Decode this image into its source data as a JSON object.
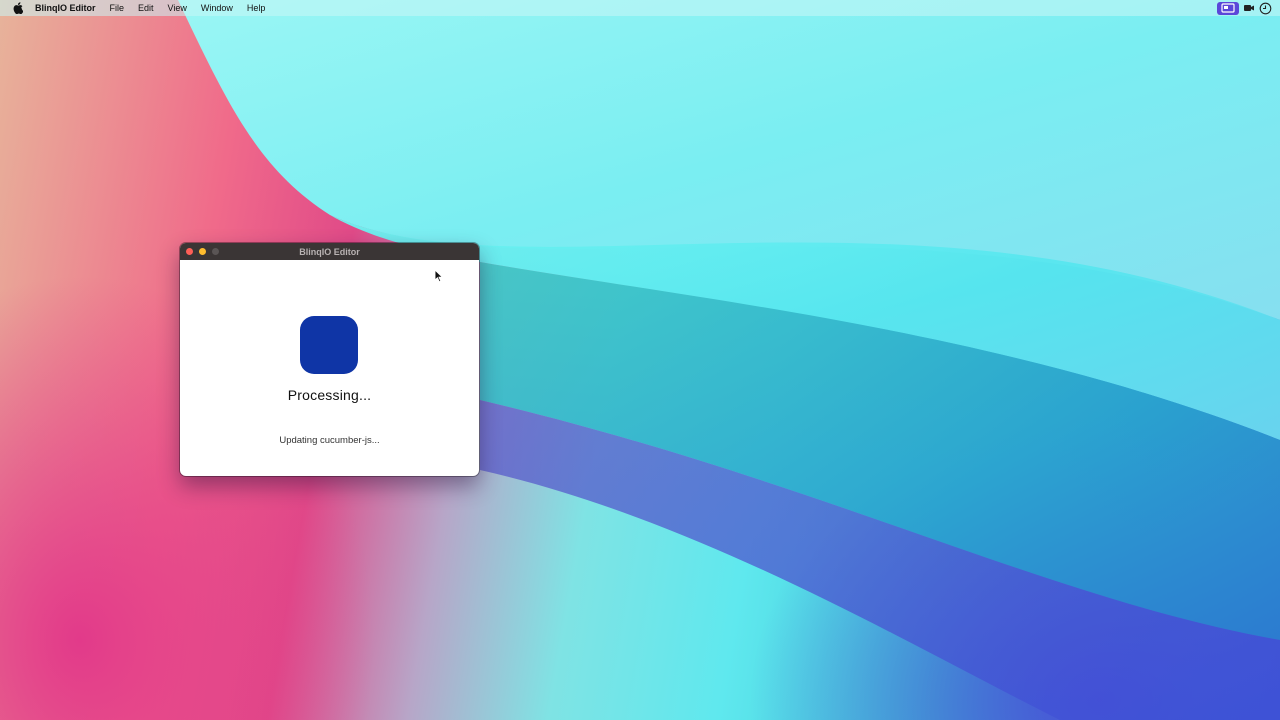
{
  "menubar": {
    "app_name": "BlinqIO Editor",
    "items": [
      "File",
      "Edit",
      "View",
      "Window",
      "Help"
    ],
    "status_icons": [
      "screen-share-icon",
      "camera-icon",
      "clock-icon"
    ]
  },
  "window": {
    "title": "BlinqIO Editor",
    "heading": "Processing...",
    "status": "Updating cucumber-js...",
    "icon_color": "#0f35a6"
  }
}
